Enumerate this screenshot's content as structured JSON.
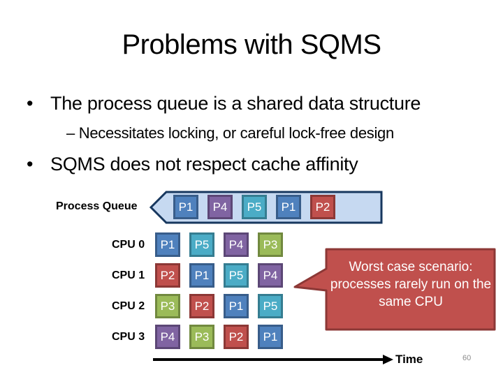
{
  "slide": {
    "title": "Problems with SQMS",
    "bullets": [
      {
        "bullet": "•",
        "text": "The process queue is a shared data structure"
      },
      {
        "bullet": "•",
        "text": "SQMS does not respect cache affinity"
      }
    ],
    "sub_bullets": [
      {
        "text": "– Necessitates locking, or careful lock-free design"
      }
    ],
    "page_number": "60"
  },
  "diagram": {
    "process_queue_label": "Process Queue",
    "process_queue": [
      "P1",
      "P4",
      "P5",
      "P1",
      "P2"
    ],
    "cpus": [
      {
        "label": "CPU 0",
        "schedule": [
          "P1",
          "P5",
          "P4",
          "P3"
        ]
      },
      {
        "label": "CPU 1",
        "schedule": [
          "P2",
          "P1",
          "P5",
          "P4"
        ]
      },
      {
        "label": "CPU 2",
        "schedule": [
          "P3",
          "P2",
          "P1",
          "P5"
        ]
      },
      {
        "label": "CPU 3",
        "schedule": [
          "P4",
          "P3",
          "P2",
          "P1"
        ]
      }
    ],
    "callout": "Worst case scenario: processes rarely run on the same CPU",
    "time_axis_label": "Time",
    "process_colors": {
      "P1": {
        "fill": "#4f81bd",
        "border": "#385d8a"
      },
      "P2": {
        "fill": "#c0504d",
        "border": "#8c3836"
      },
      "P3": {
        "fill": "#9bbb59",
        "border": "#71893f"
      },
      "P4": {
        "fill": "#8064a2",
        "border": "#5c4776"
      },
      "P5": {
        "fill": "#4bacc6",
        "border": "#357d91"
      }
    },
    "queue_fill": "#c6d9f1",
    "queue_border": "#17375e",
    "callout_fill": "#c0504d",
    "callout_border": "#8c3836"
  }
}
